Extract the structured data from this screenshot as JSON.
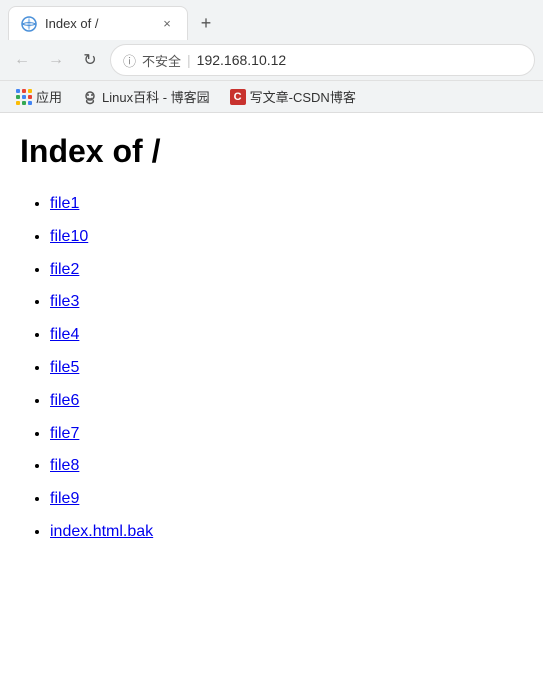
{
  "browser": {
    "tab": {
      "title": "Index of /",
      "close_label": "×",
      "new_tab_label": "+"
    },
    "nav": {
      "back_label": "←",
      "forward_label": "→",
      "reload_label": "↻",
      "security_icon_label": "ⓘ",
      "security_text": "不安全",
      "divider": "|",
      "url": "192.168.10.12"
    },
    "bookmarks": [
      {
        "id": "apps",
        "type": "apps",
        "label": "应用"
      },
      {
        "id": "linux",
        "type": "person",
        "label": "Linux百科 - 博客园"
      },
      {
        "id": "csdn",
        "type": "csdn",
        "label": "写文章-CSDN博客"
      }
    ]
  },
  "page": {
    "title": "Index of /",
    "files": [
      {
        "name": "file1",
        "href": "file1"
      },
      {
        "name": "file10",
        "href": "file10"
      },
      {
        "name": "file2",
        "href": "file2"
      },
      {
        "name": "file3",
        "href": "file3"
      },
      {
        "name": "file4",
        "href": "file4"
      },
      {
        "name": "file5",
        "href": "file5"
      },
      {
        "name": "file6",
        "href": "file6"
      },
      {
        "name": "file7",
        "href": "file7"
      },
      {
        "name": "file8",
        "href": "file8"
      },
      {
        "name": "file9",
        "href": "file9"
      },
      {
        "name": "index.html.bak",
        "href": "index.html.bak"
      }
    ]
  }
}
